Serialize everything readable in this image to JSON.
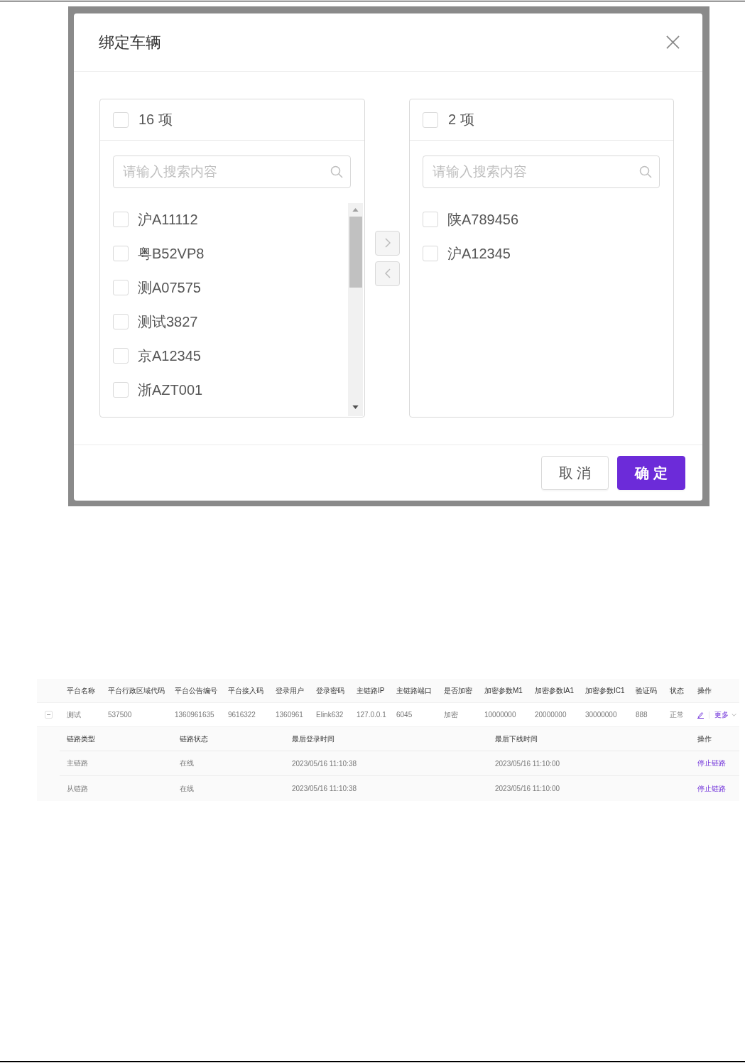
{
  "dialog": {
    "title": "绑定车辆",
    "source_panel": {
      "count_label": "16 项",
      "checked": false,
      "scrollable": true,
      "search": {
        "placeholder": "请输入搜索内容"
      },
      "items": [
        {
          "label": "沪A11112",
          "checked": false
        },
        {
          "label": "粤B52VP8",
          "checked": false
        },
        {
          "label": "测A07575",
          "checked": false
        },
        {
          "label": "测试3827",
          "checked": false
        },
        {
          "label": "京A12345",
          "checked": false
        },
        {
          "label": "浙AZT001",
          "checked": false
        }
      ]
    },
    "transfer_buttons": [
      {
        "kind": "move-right",
        "disabled": true
      },
      {
        "kind": "move-left",
        "disabled": true
      }
    ],
    "target_panel": {
      "count_label": "2 项",
      "checked": false,
      "search": {
        "placeholder": "请输入搜索内容"
      },
      "items": [
        {
          "label": "陕A789456",
          "checked": false
        },
        {
          "label": "沪A12345",
          "checked": false
        }
      ]
    },
    "buttons": [
      {
        "label": "取 消",
        "kind": "secondary"
      },
      {
        "label": "确 定",
        "kind": "primary"
      }
    ]
  },
  "table": {
    "columns": [
      "平台名称",
      "平台行政区域代码",
      "平台公告编号",
      "平台接入码",
      "登录用户",
      "登录密码",
      "主链路IP",
      "主链路端口",
      "是否加密",
      "加密参数M1",
      "加密参数IA1",
      "加密参数IC1",
      "验证码",
      "状态",
      "操作"
    ],
    "rows": [
      {
        "expanded": true,
        "cells": [
          "测试",
          "537500",
          "1360961635",
          "9616322",
          "1360961",
          "Elink632",
          "127.0.0.1",
          "6045",
          "加密",
          "10000000",
          "20000000",
          "30000000",
          "888",
          "正常"
        ],
        "more_label": "更多",
        "links": {
          "columns": [
            "链路类型",
            "链路状态",
            "最后登录时间",
            "最后下线时间",
            "操作"
          ],
          "rows": [
            {
              "cells": [
                "主链路",
                "在线",
                "2023/05/16 11:10:38",
                "2023/05/16 11:10:00"
              ],
              "action": "停止链路"
            },
            {
              "cells": [
                "从链路",
                "在线",
                "2023/05/16 11:10:38",
                "2023/05/16 11:10:00"
              ],
              "action": "停止链路"
            }
          ]
        }
      }
    ]
  }
}
